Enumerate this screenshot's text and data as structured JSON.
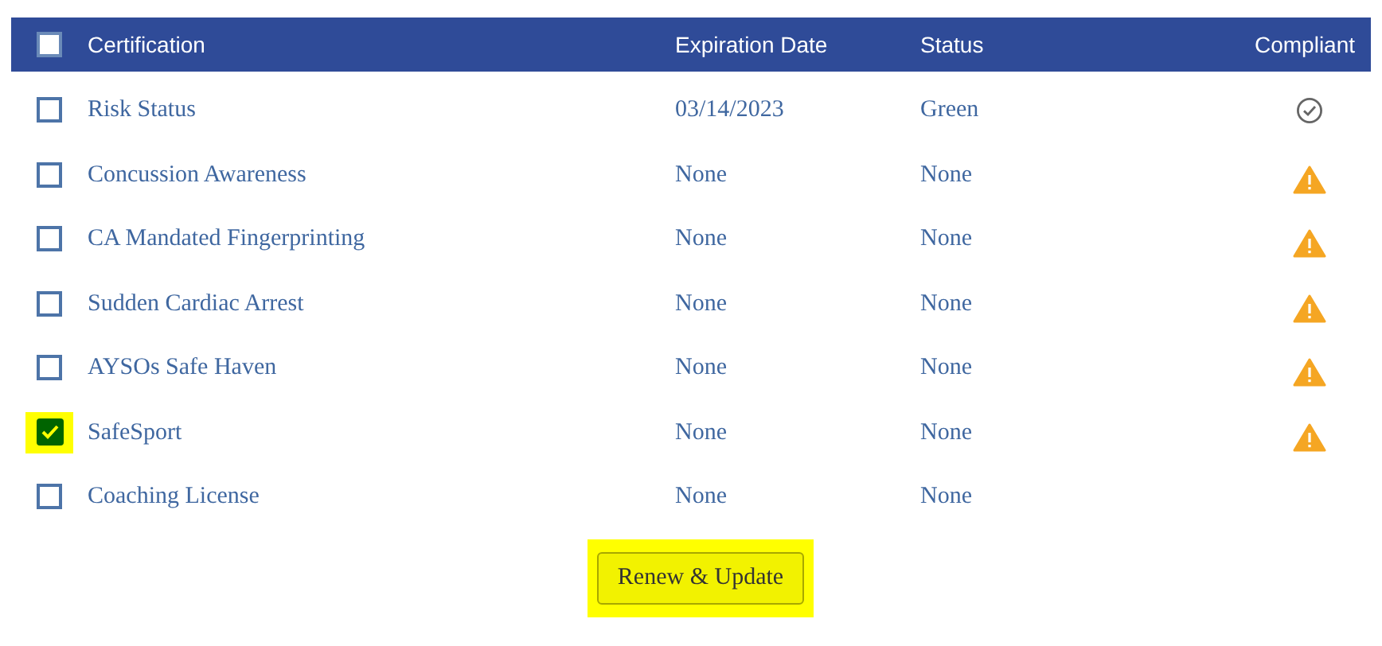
{
  "table": {
    "select_all": {
      "checked": false
    },
    "columns": [
      "Certification",
      "Expiration Date",
      "Status",
      "Compliant"
    ],
    "rows": [
      {
        "checked": false,
        "certification": "Risk Status",
        "expiration": "03/14/2023",
        "status": "Green",
        "kind": "compliant"
      },
      {
        "checked": false,
        "certification": "Concussion Awareness",
        "expiration": "None",
        "status": "None",
        "kind": "warning"
      },
      {
        "checked": false,
        "certification": "CA Mandated Fingerprinting",
        "expiration": "None",
        "status": "None",
        "kind": "warning"
      },
      {
        "checked": false,
        "certification": "Sudden Cardiac Arrest",
        "expiration": "None",
        "status": "None",
        "kind": "warning"
      },
      {
        "checked": false,
        "certification": "AYSOs Safe Haven",
        "expiration": "None",
        "status": "None",
        "kind": "warning"
      },
      {
        "checked": true,
        "certification": "SafeSport",
        "expiration": "None",
        "status": "None",
        "kind": "warning"
      },
      {
        "checked": false,
        "certification": "Coaching License",
        "expiration": "None",
        "status": "None",
        "kind": "plain"
      }
    ]
  },
  "button": "Renew & Update"
}
